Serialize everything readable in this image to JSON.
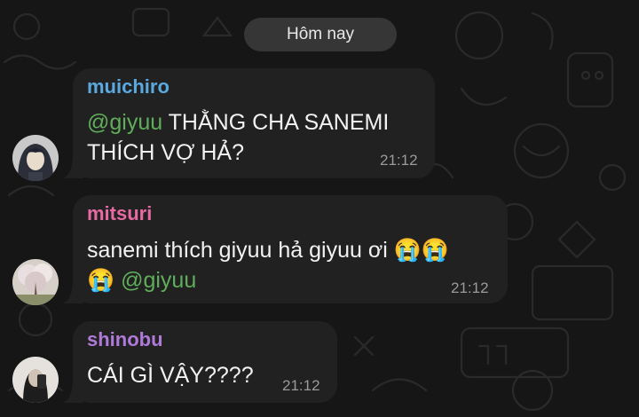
{
  "date_separator": "Hôm nay",
  "messages": [
    {
      "sender": "muichiro",
      "sender_color": "#5aa9e0",
      "mention": "@giyuu",
      "line1_rest": " THẰNG CHA SANEMI",
      "line2": "THÍCH VỢ HẢ?",
      "time": "21:12",
      "avatar_icon": "muichiro-avatar"
    },
    {
      "sender": "mitsuri",
      "sender_color": "#e86aa4",
      "line1": "sanemi thích giyuu hả giyuu ơi 😭😭",
      "line2_emoji": "😭",
      "mention": "@giyuu",
      "time": "21:12",
      "avatar_icon": "cherry-tree-avatar"
    },
    {
      "sender": "shinobu",
      "sender_color": "#b07ad8",
      "line1": "CÁI GÌ VẬY????",
      "time": "21:12",
      "avatar_icon": "mirror-selfie-avatar"
    }
  ]
}
